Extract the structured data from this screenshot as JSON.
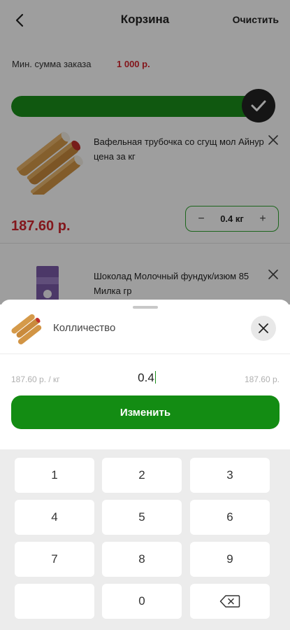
{
  "header": {
    "title": "Корзина",
    "clear_label": "Очистить"
  },
  "min_order": {
    "label": "Мин. сумма заказа",
    "value": "1 000 р."
  },
  "progress": {
    "fraction": 1.0,
    "accent": "#1b8f1b"
  },
  "cart_items": [
    {
      "name": "Вафельная трубочка со сгущ мол Айнур цена за кг",
      "price": "187.60 р.",
      "quantity": "0.4 кг",
      "image": "wafer-rolls-image"
    },
    {
      "name": "Шоколад Молочный фундук/изюм 85 Милка гр",
      "image": "milka-chocolate-image"
    }
  ],
  "sheet": {
    "title": "Колличество",
    "unit_price": "187.60 р. / кг",
    "quantity_value": "0.4",
    "total_price": "187.60 р.",
    "button_label": "Изменить"
  },
  "keypad": {
    "keys": [
      "1",
      "2",
      "3",
      "4",
      "5",
      "6",
      "7",
      "8",
      "9",
      "",
      "0",
      "backspace"
    ]
  },
  "colors": {
    "brand_green": "#138c13",
    "price_red": "#d3262e"
  }
}
